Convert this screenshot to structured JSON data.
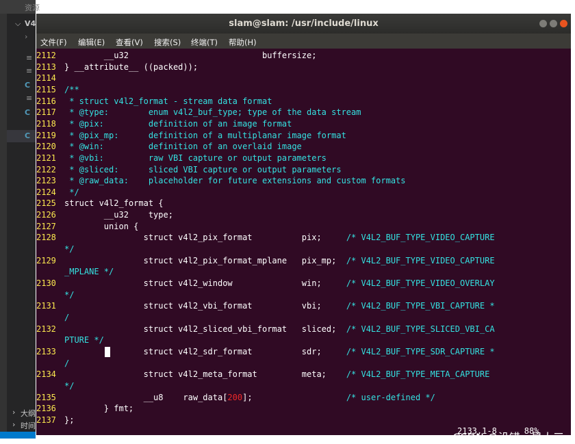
{
  "window": {
    "title": "slam@slam: /usr/include/linux"
  },
  "menu": [
    "文件(F)",
    "编辑(E)",
    "查看(V)",
    "搜索(S)",
    "终端(T)",
    "帮助(H)"
  ],
  "vscode_sidebar": {
    "header": "资源",
    "root_folder": "V4",
    "file_icons": [
      "C",
      "C",
      "C"
    ],
    "section_1": "大纲",
    "section_2": "时间"
  },
  "lines": [
    {
      "n": "2112",
      "segs": [
        {
          "t": "        __u32                           buffersize;"
        }
      ]
    },
    {
      "n": "2113",
      "segs": [
        {
          "t": "} __attribute__ ((packed));"
        }
      ]
    },
    {
      "n": "2114",
      "segs": [
        {
          "t": ""
        }
      ]
    },
    {
      "n": "2115",
      "segs": [
        {
          "t": "/**",
          "c": "cyan"
        }
      ]
    },
    {
      "n": "2116",
      "segs": [
        {
          "t": " * struct v4l2_format - stream data format",
          "c": "cyan"
        }
      ]
    },
    {
      "n": "2117",
      "segs": [
        {
          "t": " * @type:        enum v4l2_buf_type; type of the data stream",
          "c": "cyan"
        }
      ]
    },
    {
      "n": "2118",
      "segs": [
        {
          "t": " * @pix:         definition of an image format",
          "c": "cyan"
        }
      ]
    },
    {
      "n": "2119",
      "segs": [
        {
          "t": " * @pix_mp:      definition of a multiplanar image format",
          "c": "cyan"
        }
      ]
    },
    {
      "n": "2120",
      "segs": [
        {
          "t": " * @win:         definition of an overlaid image",
          "c": "cyan"
        }
      ]
    },
    {
      "n": "2121",
      "segs": [
        {
          "t": " * @vbi:         raw VBI capture or output parameters",
          "c": "cyan"
        }
      ]
    },
    {
      "n": "2122",
      "segs": [
        {
          "t": " * @sliced:      sliced VBI capture or output parameters",
          "c": "cyan"
        }
      ]
    },
    {
      "n": "2123",
      "segs": [
        {
          "t": " * @raw_data:    placeholder for future extensions and custom formats",
          "c": "cyan"
        }
      ]
    },
    {
      "n": "2124",
      "segs": [
        {
          "t": " */",
          "c": "cyan"
        }
      ]
    },
    {
      "n": "2125",
      "segs": [
        {
          "t": "struct v4l2_format {"
        }
      ]
    },
    {
      "n": "2126",
      "segs": [
        {
          "t": "        __u32    type;"
        }
      ]
    },
    {
      "n": "2127",
      "segs": [
        {
          "t": "        union {"
        }
      ]
    },
    {
      "n": "2128",
      "segs": [
        {
          "t": "                struct v4l2_pix_format          pix;     "
        },
        {
          "t": "/* V4L2_BUF_TYPE_VIDEO_CAPTURE",
          "c": "cyan"
        }
      ],
      "cont": "*/"
    },
    {
      "n": "2129",
      "segs": [
        {
          "t": "                struct v4l2_pix_format_mplane   pix_mp;  "
        },
        {
          "t": "/* V4L2_BUF_TYPE_VIDEO_CAPTURE",
          "c": "cyan"
        }
      ],
      "cont": "_MPLANE */"
    },
    {
      "n": "2130",
      "segs": [
        {
          "t": "                struct v4l2_window              win;     "
        },
        {
          "t": "/* V4L2_BUF_TYPE_VIDEO_OVERLAY",
          "c": "cyan"
        }
      ],
      "cont": "*/"
    },
    {
      "n": "2131",
      "segs": [
        {
          "t": "                struct v4l2_vbi_format          vbi;     "
        },
        {
          "t": "/* V4L2_BUF_TYPE_VBI_CAPTURE *",
          "c": "cyan"
        }
      ],
      "cont": "/"
    },
    {
      "n": "2132",
      "segs": [
        {
          "t": "                struct v4l2_sliced_vbi_format   sliced;  "
        },
        {
          "t": "/* V4L2_BUF_TYPE_SLICED_VBI_CA",
          "c": "cyan"
        }
      ],
      "cont": "PTURE */"
    },
    {
      "n": "2133",
      "segs": [
        {
          "t": "                struct v4l2_sdr_format          sdr;     "
        },
        {
          "t": "/* V4L2_BUF_TYPE_SDR_CAPTURE *",
          "c": "cyan"
        }
      ],
      "cont": "/"
    },
    {
      "n": "2134",
      "segs": [
        {
          "t": "                struct v4l2_meta_format         meta;    "
        },
        {
          "t": "/* V4L2_BUF_TYPE_META_CAPTURE",
          "c": "cyan"
        }
      ],
      "cont": "*/"
    },
    {
      "n": "2135",
      "segs": [
        {
          "t": "                __u8    raw_data["
        },
        {
          "t": "200",
          "c": "red"
        },
        {
          "t": "];                   "
        },
        {
          "t": "/* user-defined */",
          "c": "cyan"
        }
      ]
    },
    {
      "n": "2136",
      "segs": [
        {
          "t": "        } fmt;"
        }
      ]
    },
    {
      "n": "2137",
      "segs": [
        {
          "t": "};"
        }
      ]
    }
  ],
  "status": {
    "position": "2133,1-8",
    "percent": "88%"
  },
  "watermark": "CSDN @没错，是大三"
}
